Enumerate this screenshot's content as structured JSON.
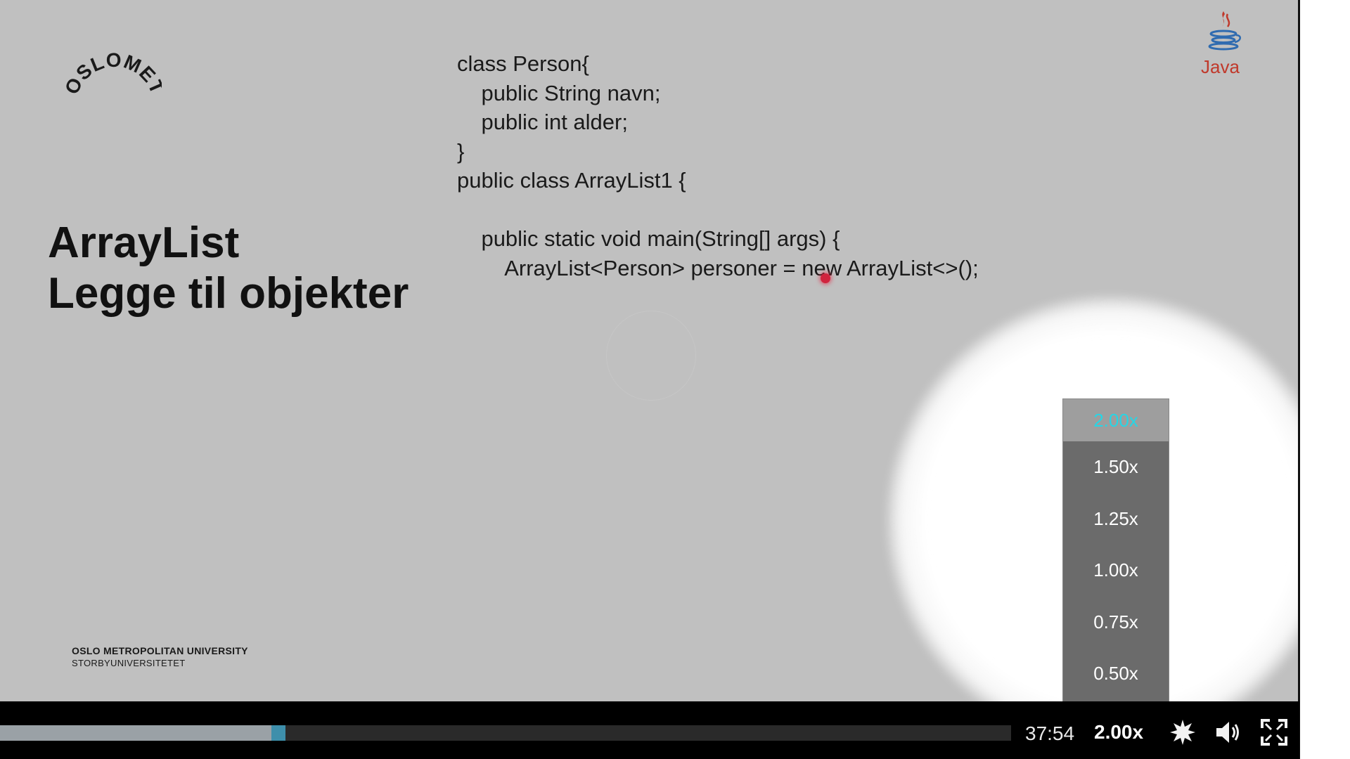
{
  "slide": {
    "logo_text": "OSLOMET",
    "java_label": "Java",
    "title_line1": "ArrayList",
    "title_line2": "Legge til objekter",
    "code_lines": [
      "class Person{",
      "    public String navn;",
      "    public int alder;",
      "}",
      "public class ArrayList1 {",
      "",
      "    public static void main(String[] args) {",
      "        ArrayList<Person> personer = new ArrayList<>();"
    ],
    "university_name": "OSLO METROPOLITAN UNIVERSITY",
    "university_subtitle": "STORBYUNIVERSITETET"
  },
  "speed_menu": {
    "options": [
      "2.00x",
      "1.50x",
      "1.25x",
      "1.00x",
      "0.75x",
      "0.50x"
    ],
    "selected": "2.00x",
    "selected_color": "#25d6e6"
  },
  "player": {
    "time": "37:54",
    "speed_label": "2.00x",
    "progress_fraction": 0.2685,
    "buffer_fraction": 0.282,
    "icons": [
      "settings-icon",
      "volume-icon",
      "fullscreen-icon"
    ]
  }
}
